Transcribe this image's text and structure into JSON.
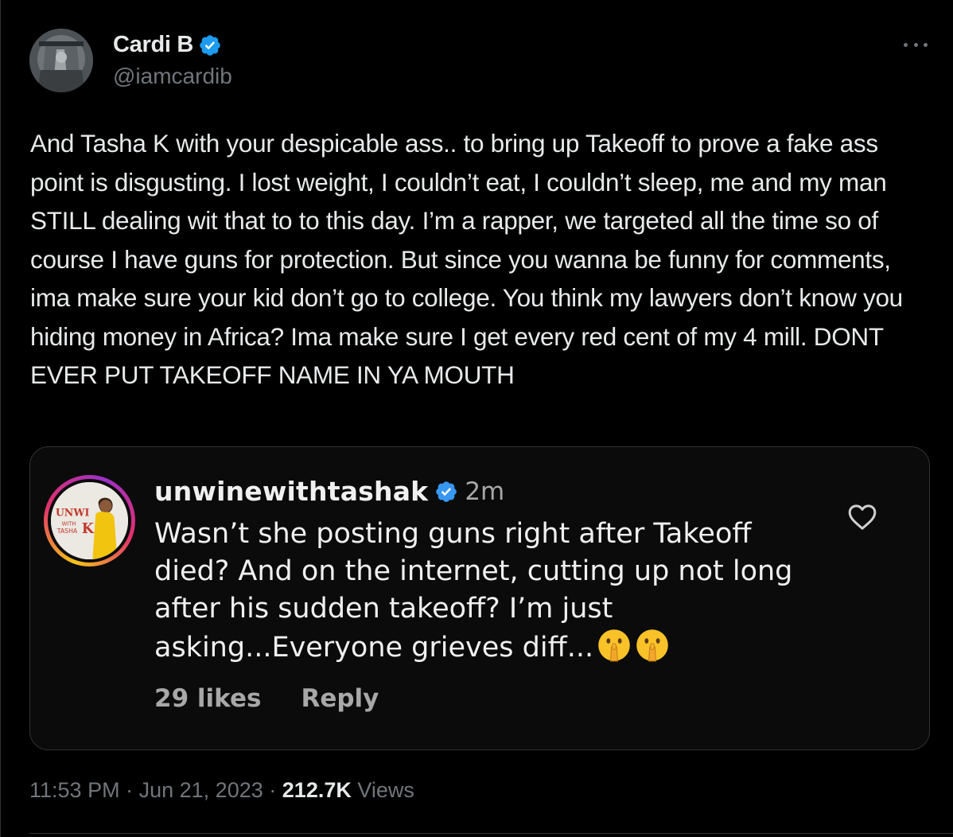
{
  "author": {
    "display_name": "Cardi B",
    "handle": "@iamcardib",
    "verified": true,
    "accent_color": "#1d9bf0"
  },
  "tweet": {
    "text": "And Tasha K with your despicable ass.. to bring up Takeoff to prove a fake ass point is disgusting. I lost weight, I couldn’t eat, I couldn’t sleep, me and my man STILL dealing wit that to to this day. I’m a rapper, we targeted all the time so of course I have guns for protection. But since you wanna be funny for comments, ima make sure your kid don’t go to college. You think my lawyers don’t know you hiding money in Africa? Ima make sure I get every red cent of my 4 mill. DONT EVER PUT TAKEOFF NAME IN YA MOUTH"
  },
  "embedded_comment": {
    "username": "unwinewithtashak",
    "verified": true,
    "time": "2m",
    "text": "Wasn’t she posting guns right after Takeoff died? And on the internet, cutting up not long after his sudden takeoff? I’m just asking...Everyone grieves diff...",
    "emoji": [
      "shushing-face",
      "shushing-face"
    ],
    "likes": "29 likes",
    "reply_label": "Reply"
  },
  "meta": {
    "time": "11:53 PM",
    "separator": "·",
    "date": "Jun 21, 2023",
    "views_count": "212.7K",
    "views_label": "Views"
  },
  "icons": {
    "more": "more-horizontal-icon",
    "verified": "verified-badge-icon",
    "heart": "heart-outline-icon"
  }
}
